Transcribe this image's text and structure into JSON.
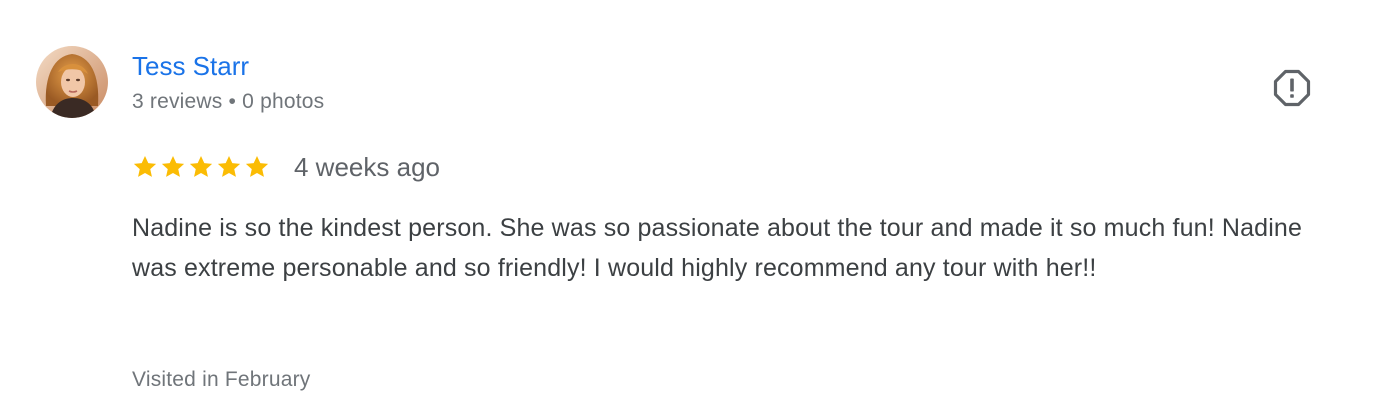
{
  "review": {
    "author": {
      "name": "Tess Starr",
      "reviews_count": "3 reviews",
      "separator": "•",
      "photos_count": "0 photos",
      "avatar_icon": "profile-photo"
    },
    "rating": {
      "stars": 5,
      "max": 5,
      "star_color": "#fbbc04"
    },
    "date": "4 weeks ago",
    "text": "Nadine is so the kindest person. She was so passionate about the tour and made it so much fun! Nadine was extreme personable and so friendly! I would highly recommend any tour with her!!",
    "visited": "Visited in February",
    "report_icon": "report-alert-icon"
  },
  "colors": {
    "name_link": "#1a73e8",
    "secondary_text": "#70757a",
    "body_text": "#3c4043",
    "icon": "#5f6368"
  }
}
